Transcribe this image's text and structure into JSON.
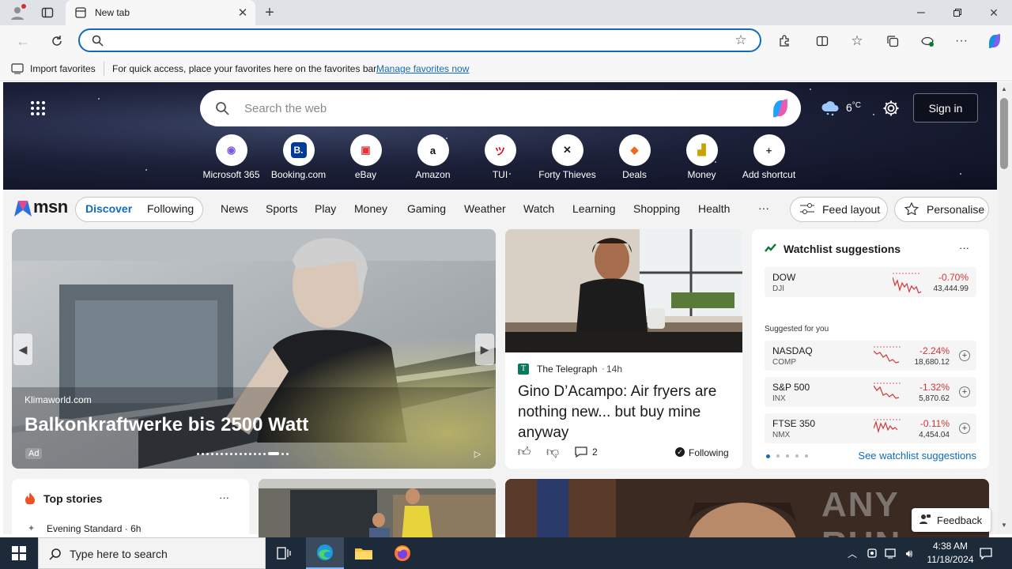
{
  "browser": {
    "tab_title": "New tab",
    "favorites_import": "Import favorites",
    "favorites_hint": "For quick access, place your favorites here on the favorites bar.",
    "favorites_link": "Manage favorites now"
  },
  "hero": {
    "search_placeholder": "Search the web",
    "weather_temp": "6",
    "weather_unit": "°C",
    "sign_in": "Sign in",
    "shortcuts": [
      {
        "label": "Microsoft 365",
        "glyph": "◉",
        "color": "#7b5cd6"
      },
      {
        "label": "Booking.com",
        "glyph": "B.",
        "color": "#003b95"
      },
      {
        "label": "eBay",
        "glyph": "▣",
        "color": "#e53238"
      },
      {
        "label": "Amazon",
        "glyph": "a",
        "color": "#111111"
      },
      {
        "label": "TUI",
        "glyph": "ツ",
        "color": "#e2001a"
      },
      {
        "label": "Forty Thieves",
        "glyph": "✕",
        "color": "#222222"
      },
      {
        "label": "Deals",
        "glyph": "◆",
        "color": "#f06a1d"
      },
      {
        "label": "Money",
        "glyph": "▟",
        "color": "#c8a200"
      },
      {
        "label": "Add shortcut",
        "glyph": "+",
        "color": "#333333"
      }
    ]
  },
  "nav": {
    "brand": "msn",
    "discover": "Discover",
    "following": "Following",
    "items": [
      "News",
      "Sports",
      "Play",
      "Money",
      "Gaming",
      "Weather",
      "Watch",
      "Learning",
      "Shopping",
      "Health"
    ],
    "more": "···",
    "feed_layout": "Feed layout",
    "personalise": "Personalise"
  },
  "main_card": {
    "source": "Klimaworld.com",
    "headline": "Balkonkraftwerke bis 2500 Watt",
    "ad": "Ad"
  },
  "story_card": {
    "source": "The Telegraph",
    "age": "14h",
    "headline": "Gino D’Acampo: Air fryers are nothing new... but buy mine anyway",
    "comments": "2",
    "following": "Following"
  },
  "watchlist": {
    "title": "Watchlist suggestions",
    "more": "···",
    "suggested_label": "Suggested for you",
    "see_more": "See watchlist suggestions",
    "primary": {
      "name": "DOW",
      "ticker": "DJI",
      "change": "-0.70%",
      "price": "43,444.99"
    },
    "items": [
      {
        "name": "NASDAQ",
        "ticker": "COMP",
        "change": "-2.24%",
        "price": "18,680.12"
      },
      {
        "name": "S&P 500",
        "ticker": "INX",
        "change": "-1.32%",
        "price": "5,870.62"
      },
      {
        "name": "FTSE 350",
        "ticker": "NMX",
        "change": "-0.11%",
        "price": "4,454.04"
      }
    ]
  },
  "bottom": {
    "top_stories": "Top stories",
    "top_stories_more": "···",
    "story_source": "Evening Standard",
    "story_age": "6h",
    "feedback": "Feedback",
    "watermark": "ANY RUN"
  },
  "taskbar": {
    "search_placeholder": "Type here to search",
    "time": "4:38 AM",
    "date": "11/18/2024"
  },
  "colors": {
    "accent": "#0f6cbd",
    "negative": "#d13438",
    "taskbar": "#1c2a3a"
  }
}
